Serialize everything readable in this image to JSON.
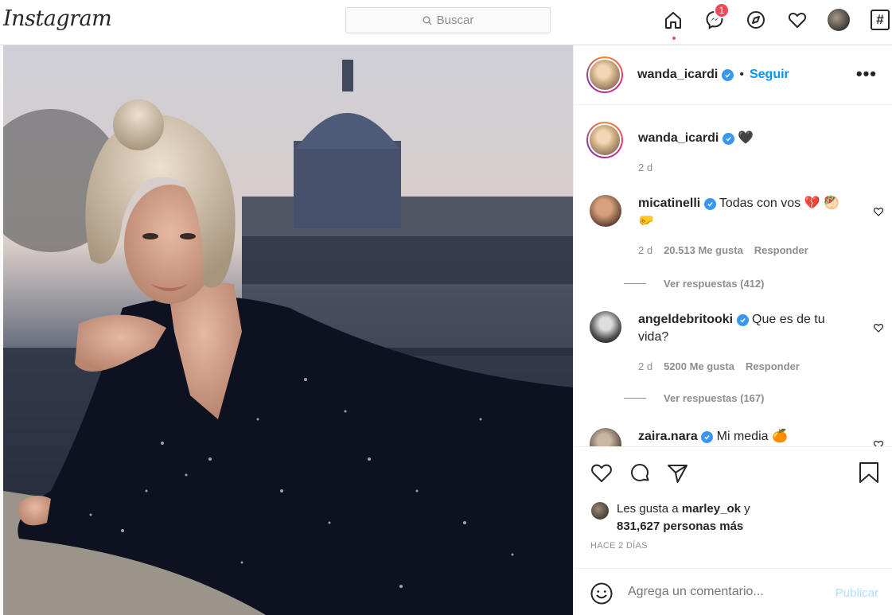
{
  "topbar": {
    "logo": "Instagram",
    "search_placeholder": "Buscar",
    "notifications_badge": "1",
    "extra_icon_label": "#"
  },
  "post": {
    "username": "wanda_icardi",
    "follow_label": "Seguir",
    "separator": "•",
    "more_label": "•••",
    "caption": {
      "username": "wanda_icardi",
      "text": "🖤",
      "time": "2 d"
    }
  },
  "comments": [
    {
      "username": "micatinelli",
      "text": "Todas con vos 💔 🥙",
      "text_line2": "🤛",
      "time": "2 d",
      "likes": "20.513 Me gusta",
      "reply_label": "Responder",
      "view_replies": "Ver respuestas (412)"
    },
    {
      "username": "angeldebritooki",
      "text": "Que es de tu",
      "text_line2": "vida?",
      "time": "2 d",
      "likes": "5200 Me gusta",
      "reply_label": "Responder",
      "view_replies": "Ver respuestas (167)"
    },
    {
      "username": "zaira.nara",
      "text": "Mi media 🍊"
    }
  ],
  "likes": {
    "prefix": "Les gusta a",
    "user": "marley_ok",
    "suffix": "y",
    "others": "831,627 personas más"
  },
  "timestamp": "HACE 2 DÍAS",
  "add_comment": {
    "placeholder": "Agrega un comentario...",
    "publish_label": "Publicar"
  },
  "colors": {
    "link_blue": "#0095f6",
    "verified_blue": "#3897f0",
    "notification_red": "#ed4956",
    "publish_disabled": "#b2dffc",
    "secondary_text": "#8e8e8e"
  }
}
